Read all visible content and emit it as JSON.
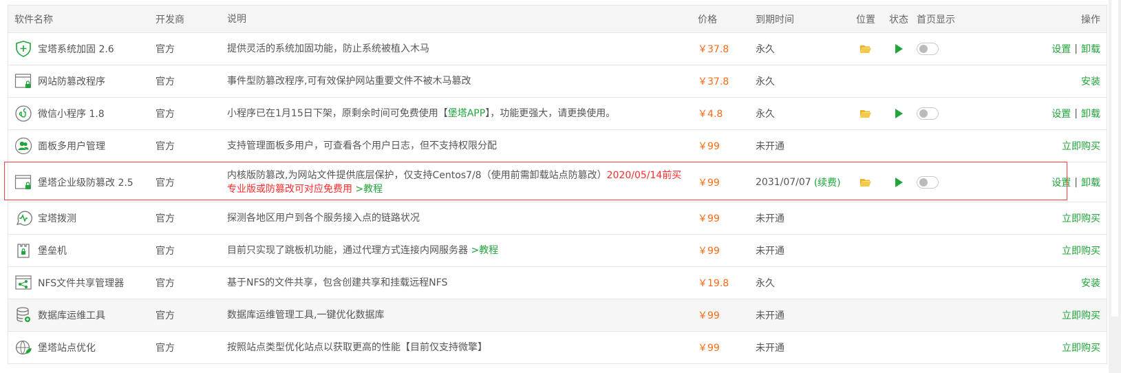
{
  "header": {
    "name": "软件名称",
    "dev": "开发商",
    "desc": "说明",
    "price": "价格",
    "expiry": "到期时间",
    "location": "位置",
    "status": "状态",
    "home": "首页显示",
    "ops": "操作"
  },
  "rows": [
    {
      "name": "宝塔系统加固 2.6",
      "dev": "官方",
      "desc": "提供灵活的系统加固功能，防止系统被植入木马",
      "price": "￥37.8",
      "expiry": "永久",
      "icon": "shield-plus-icon",
      "installed": true,
      "op1": "设置",
      "op2": "卸载"
    },
    {
      "name": "网站防篡改程序",
      "dev": "官方",
      "desc": "事件型防篡改程序,可有效保护网站重要文件不被木马篡改",
      "price": "￥37.8",
      "expiry": "永久",
      "icon": "window-lock-icon",
      "installed": false,
      "op1": "安装"
    },
    {
      "name": "微信小程序 1.8",
      "dev": "官方",
      "desc_a": "小程序已在1月15日下架，原剩余时间可免费使用【",
      "desc_link": "堡塔APP",
      "desc_b": "】，功能更强大，请更换使用。",
      "price": "￥4.8",
      "expiry": "永久",
      "icon": "mini-program-icon",
      "installed": true,
      "op1": "设置",
      "op2": "卸载"
    },
    {
      "name": "面板多用户管理",
      "dev": "官方",
      "desc": "支持管理面板多用户，可查看各个用户日志，但不支持权限分配",
      "price": "￥99",
      "expiry": "未开通",
      "icon": "users-icon",
      "installed": false,
      "op1": "立即购买"
    },
    {
      "name": "堡塔企业级防篡改 2.5",
      "dev": "官方",
      "desc_a": "内核版防篡改,为网站文件提供底层保护，仅支持Centos7/8（使用前需卸载站点防篡改）",
      "desc_red": "2020/05/14前买专业版或防篡改可对应免费用",
      "desc_link": " >教程",
      "price": "￥99",
      "expiry": "2031/07/07",
      "renew": "(续费)",
      "icon": "window-lock-icon",
      "installed": true,
      "op1": "设置",
      "op2": "卸载"
    },
    {
      "name": "宝塔拨测",
      "dev": "官方",
      "desc": "探测各地区用户到各个服务接入点的链路状况",
      "price": "￥99",
      "expiry": "未开通",
      "icon": "probe-icon",
      "installed": false,
      "op1": "立即购买"
    },
    {
      "name": "堡垒机",
      "dev": "官方",
      "desc_a": "目前只实现了跳板机功能，通过代理方式连接内网服务器",
      "desc_link": " >教程",
      "price": "￥99",
      "expiry": "未开通",
      "icon": "fortress-icon",
      "installed": false,
      "op1": "立即购买"
    },
    {
      "name": "NFS文件共享管理器",
      "dev": "官方",
      "desc": "基于NFS的文件共享，包含创建共享和挂载远程NFS",
      "price": "￥19.8",
      "expiry": "永久",
      "icon": "share-icon",
      "installed": false,
      "op1": "安装"
    },
    {
      "name": "数据库运维工具",
      "dev": "官方",
      "desc": "数据库运维管理工具,一键优化数据库",
      "price": "￥99",
      "expiry": "未开通",
      "icon": "database-icon",
      "installed": false,
      "op1": "立即购买"
    },
    {
      "name": "堡塔站点优化",
      "dev": "官方",
      "desc": "按照站点类型优化站点以获取更高的性能【目前仅支持微擎】",
      "price": "￥99",
      "expiry": "未开通",
      "icon": "site-optimize-icon",
      "installed": false,
      "op1": "立即购买"
    }
  ],
  "colors": {
    "accent": "#20a53a",
    "price": "#ff6a13",
    "highlight": "#ff2b2b"
  }
}
